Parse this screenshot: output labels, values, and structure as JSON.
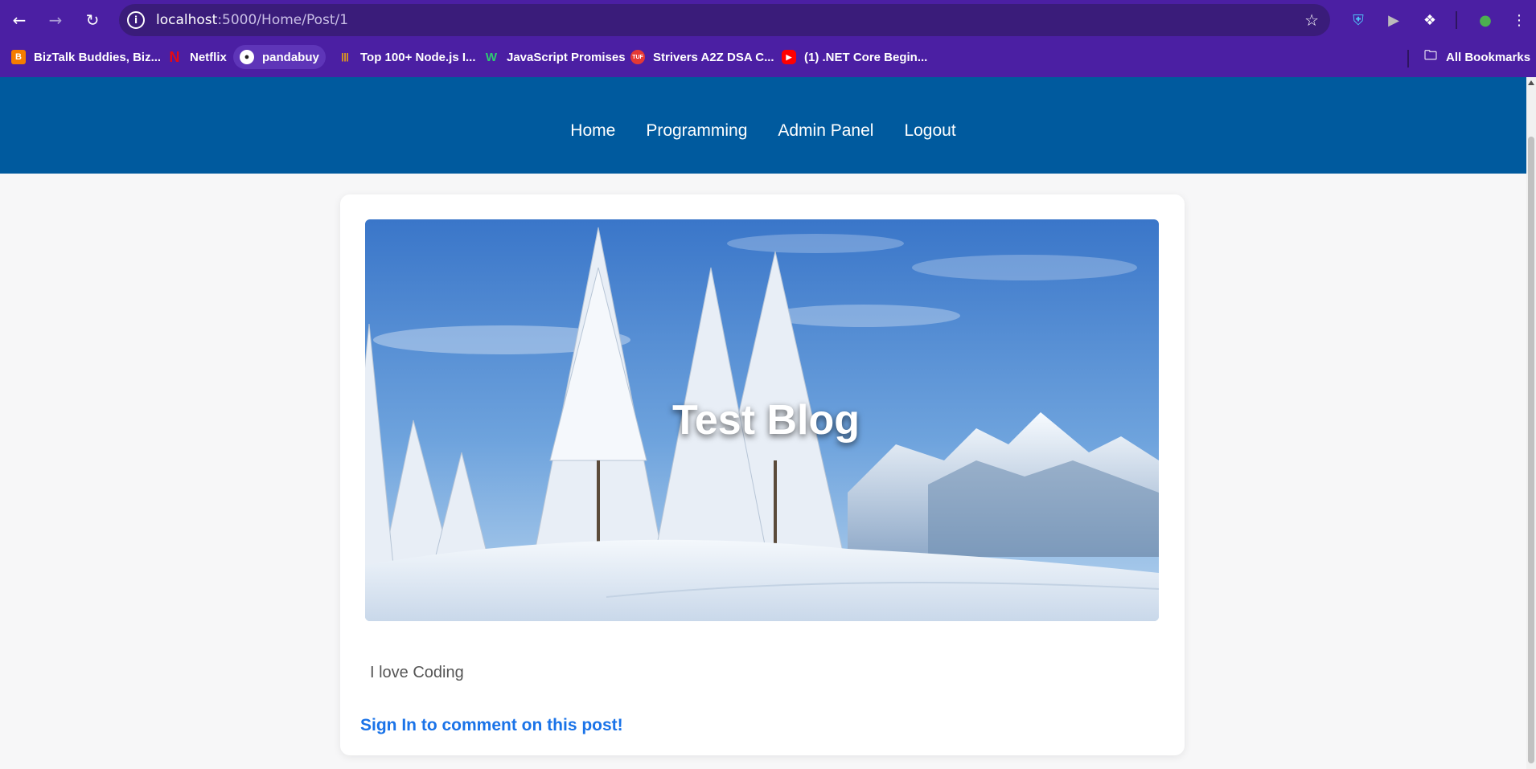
{
  "browser": {
    "url_host": "localhost",
    "url_path": ":5000/Home/Post/1",
    "bookmarks": [
      {
        "label": "BizTalk Buddies, Biz...",
        "icon": "blogger-icon",
        "color": "#f57c00"
      },
      {
        "label": "Netflix",
        "icon": "netflix-icon",
        "color": "#e50914"
      },
      {
        "label": "pandabuy",
        "icon": "panda-icon",
        "color": "#ffffff"
      },
      {
        "label": "Top 100+ Node.js I...",
        "icon": "bar-chart-icon",
        "color": "#ffb300"
      },
      {
        "label": "JavaScript Promises",
        "icon": "w-icon",
        "color": "#2ecc71"
      },
      {
        "label": "Strivers A2Z DSA C...",
        "icon": "tuf-icon",
        "color": "#e53935"
      },
      {
        "label": "(1) .NET Core Begin...",
        "icon": "youtube-icon",
        "color": "#ff0000"
      }
    ],
    "all_bookmarks": "All Bookmarks"
  },
  "site": {
    "nav": [
      "Home",
      "Programming",
      "Admin Panel",
      "Logout"
    ],
    "header_color": "#005a9e"
  },
  "post": {
    "title": "Test Blog",
    "body": "I love Coding",
    "signin_link": "Sign In to comment on this post!"
  }
}
